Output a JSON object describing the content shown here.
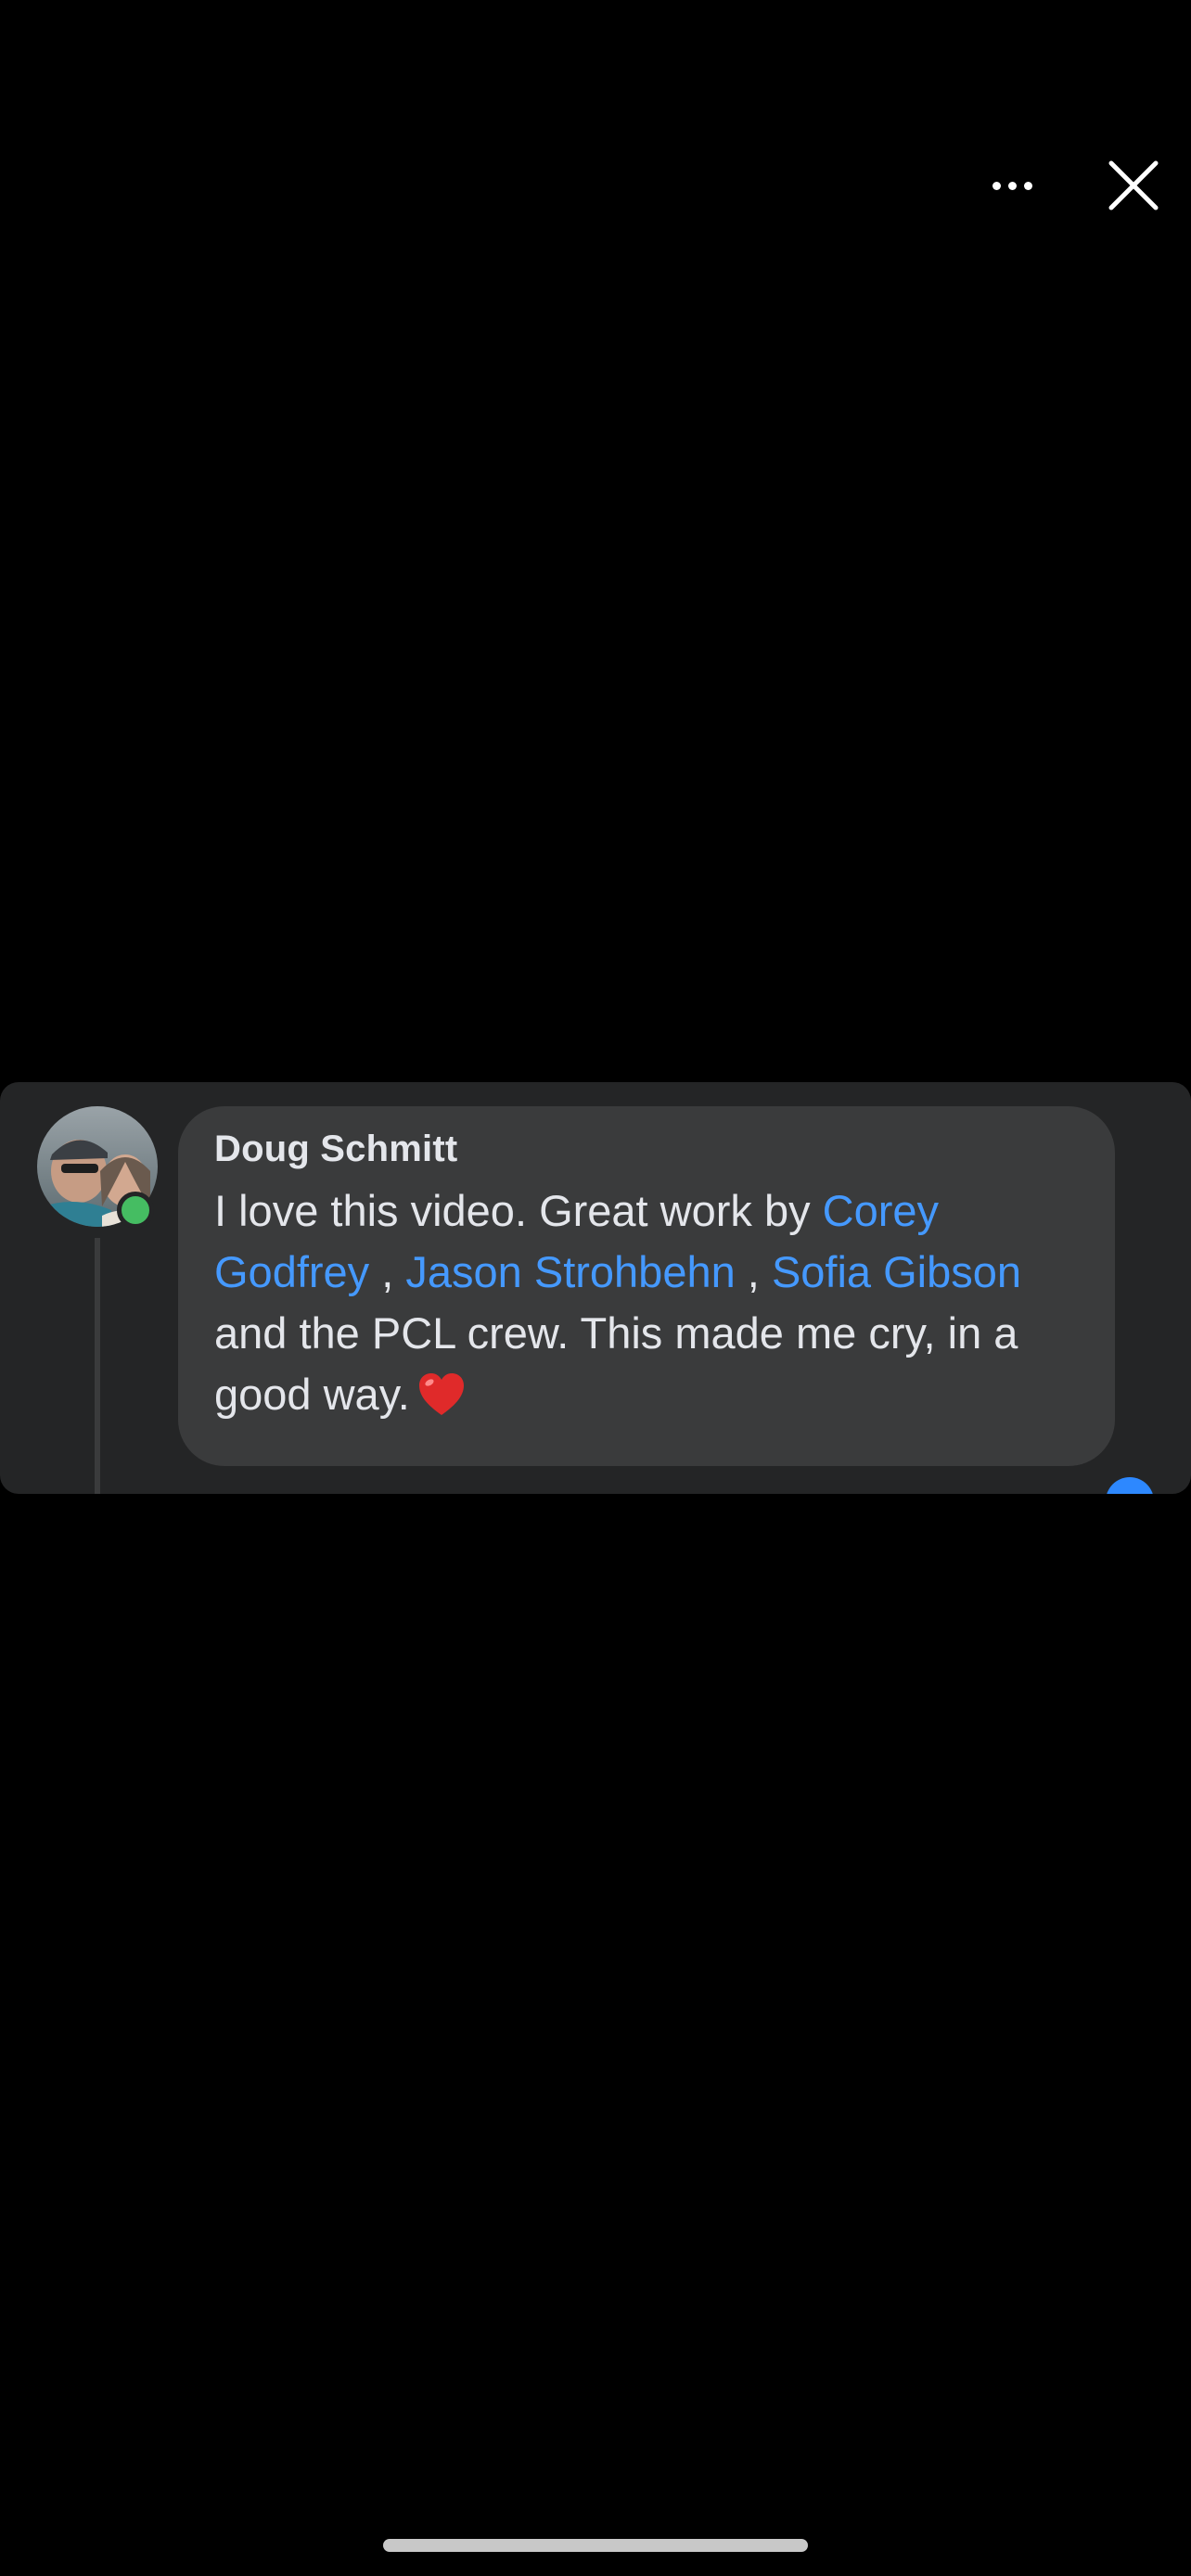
{
  "header": {
    "more_icon": "ellipsis-horizontal-icon",
    "close_icon": "close-x-icon"
  },
  "comment": {
    "author": "Doug Schmitt",
    "text_parts": {
      "part1": "I love this video. Great work by ",
      "mention1": "Corey Godfrey",
      "sep1": " , ",
      "mention2": "Jason Strohbehn",
      "sep2": " , ",
      "mention3": "Sofia Gibson",
      "part2": " and the PCL crew. This made me cry, in a good way."
    },
    "emoji": "red-heart-emoji",
    "online": true
  },
  "colors": {
    "background": "#000000",
    "panel": "#242526",
    "bubble": "#3a3b3c",
    "mention": "#4599ff",
    "online": "#45bd62"
  }
}
